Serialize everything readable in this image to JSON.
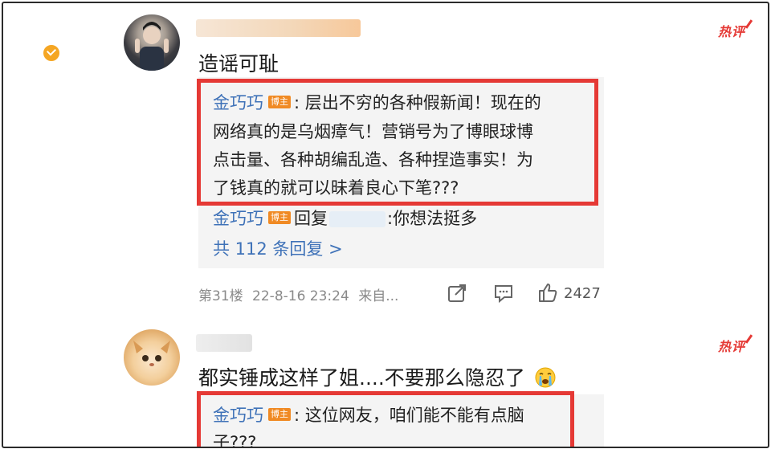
{
  "comments": [
    {
      "text": "造谣可耻",
      "hot_label": "热评",
      "reply_author": "金巧巧",
      "reply_tag": "博主",
      "reply_text_1": ": 层出不穷的各种假新闻！现在的",
      "reply_text_2": "网络真的是乌烟瘴气！营销号为了博眼球博",
      "reply_text_3": "点击量、各种胡编乱造、各种捏造事实！为",
      "reply_text_4": "了钱真的就可以昧着良心下笔???",
      "second_reply_author": "金巧巧",
      "second_reply_tag": "博主",
      "second_reply_prefix": "回复",
      "second_reply_suffix": ":你想法挺多",
      "more_replies": "共 112 条回复 >",
      "floor": "第31楼",
      "time": "22-8-16 23:24",
      "source": "来自...",
      "likes": "2427"
    },
    {
      "text": "都实锤成这样了姐....不要那么隐忍了",
      "hot_label": "热评",
      "reply_author": "金巧巧",
      "reply_tag": "博主",
      "reply_text_1": ": 这位网友，咱们能不能有点脑",
      "reply_text_2": "子???"
    }
  ]
}
